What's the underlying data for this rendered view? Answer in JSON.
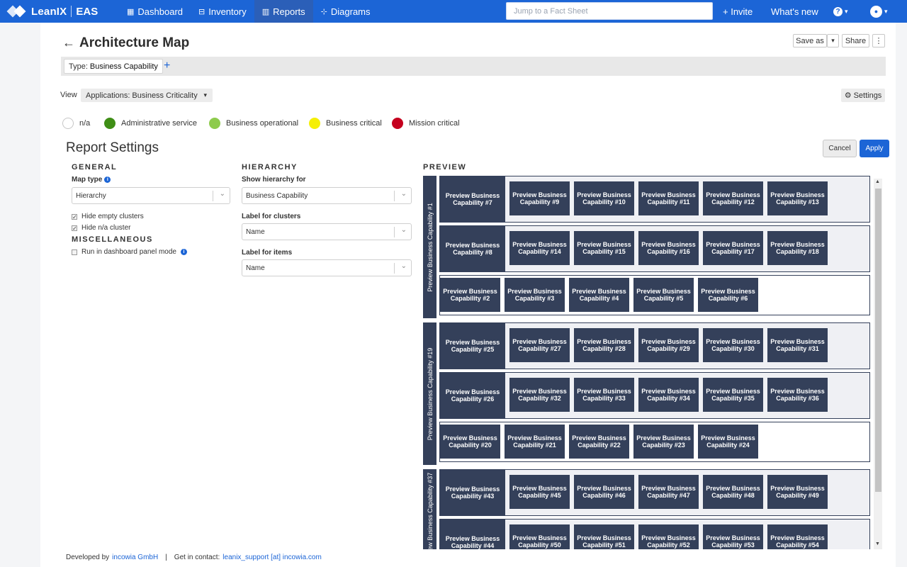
{
  "nav": {
    "brand": "LeanIX",
    "workspace": "EAS",
    "items": [
      {
        "label": "Dashboard",
        "icon": "dashboard-icon",
        "glyph": "▦"
      },
      {
        "label": "Inventory",
        "icon": "inventory-icon",
        "glyph": "⊟"
      },
      {
        "label": "Reports",
        "icon": "reports-icon",
        "glyph": "▥"
      },
      {
        "label": "Diagrams",
        "icon": "diagrams-icon",
        "glyph": "⊹"
      }
    ],
    "search_placeholder": "Jump to a Fact Sheet",
    "invite": "+ Invite",
    "whats_new": "What's new",
    "help": "?",
    "caret": "▾",
    "user_glyph": "●"
  },
  "header": {
    "title": "Architecture Map",
    "save_as": "Save as",
    "share": "Share",
    "more": "⋮"
  },
  "filter": {
    "type_label": "Type:",
    "type_value": "Business Capability",
    "add": "+"
  },
  "view": {
    "label": "View",
    "selected": "Applications: Business Criticality",
    "settings": "Settings"
  },
  "legend": [
    {
      "label": "n/a",
      "color": "#ffffff"
    },
    {
      "label": "Administrative service",
      "color": "#3f8e16"
    },
    {
      "label": "Business operational",
      "color": "#8ecb4d"
    },
    {
      "label": "Business critical",
      "color": "#f5ef06"
    },
    {
      "label": "Mission critical",
      "color": "#c5001e"
    }
  ],
  "report_settings": {
    "title": "Report Settings",
    "cancel": "Cancel",
    "apply": "Apply",
    "general": {
      "heading": "GENERAL",
      "map_type_label": "Map type",
      "map_type_value": "Hierarchy",
      "hide_empty": "Hide empty clusters",
      "hide_na": "Hide n/a cluster"
    },
    "misc": {
      "heading": "MISCELLANEOUS",
      "dashboard_mode": "Run in dashboard panel mode"
    },
    "hierarchy": {
      "heading": "HIERARCHY",
      "show_for_label": "Show hierarchy for",
      "show_for_value": "Business Capability",
      "clusters_label": "Label for clusters",
      "clusters_value": "Name",
      "items_label": "Label for items",
      "items_value": "Name"
    }
  },
  "preview": {
    "heading": "PREVIEW",
    "groups": [
      {
        "label": "Preview Business Capability #1",
        "rows": [
          {
            "head": "Preview Business Capability #7",
            "items": [
              "#9",
              "#10",
              "#11",
              "#12",
              "#13"
            ]
          },
          {
            "head": "Preview Business Capability #8",
            "items": [
              "#14",
              "#15",
              "#16",
              "#17",
              "#18"
            ]
          },
          {
            "head": null,
            "items": [
              "#2",
              "#3",
              "#4",
              "#5",
              "#6"
            ]
          }
        ]
      },
      {
        "label": "Preview Business Capability #19",
        "rows": [
          {
            "head": "Preview Business Capability #25",
            "items": [
              "#27",
              "#28",
              "#29",
              "#30",
              "#31"
            ]
          },
          {
            "head": "Preview Business Capability #26",
            "items": [
              "#32",
              "#33",
              "#34",
              "#35",
              "#36"
            ]
          },
          {
            "head": null,
            "items": [
              "#20",
              "#21",
              "#22",
              "#23",
              "#24"
            ]
          }
        ]
      },
      {
        "label": "Preview Business Capability #37",
        "rows": [
          {
            "head": "Preview Business Capability #43",
            "items": [
              "#45",
              "#46",
              "#47",
              "#48",
              "#49"
            ]
          },
          {
            "head": "Preview Business Capability #44",
            "items": [
              "#50",
              "#51",
              "#52",
              "#53",
              "#54"
            ]
          }
        ]
      }
    ]
  },
  "footer": {
    "developed_by": "Developed by",
    "company": "incowia GmbH",
    "separator": "|",
    "contact_label": "Get in contact:",
    "contact_link": "leanix_support [at] incowia.com"
  }
}
